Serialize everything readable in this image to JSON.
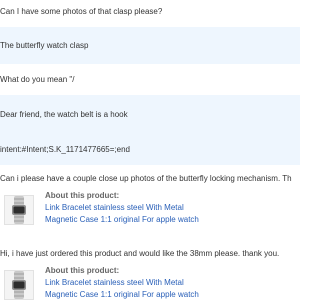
{
  "messages": [
    {
      "role": "buyer",
      "text": "Can I have some photos of that clasp please?"
    },
    {
      "role": "seller",
      "text": "The butterfly watch clasp"
    },
    {
      "role": "buyer",
      "text": "What do you mean \"/"
    },
    {
      "role": "seller",
      "text": "Dear friend, the watch belt is a hook"
    },
    {
      "role": "seller",
      "text": "intent:#Intent;S.K_1171477665=;end"
    },
    {
      "role": "buyer",
      "text": "Can i please have a couple close up photos of the butterfly locking mechanism. Th"
    },
    {
      "role": "buyer",
      "text": "Hi, i have just ordered this product and would like the 38mm please. thank you."
    }
  ],
  "product_card": {
    "title": "About this product:",
    "link_line1": "Link Bracelet stainless steel With Metal",
    "link_line2": "Magnetic Case 1:1 original For apple watch",
    "thumbnail_icon": "watch-bracelet-thumbnail"
  },
  "colors": {
    "seller_background": "#eef6fe",
    "buyer_background": "#ffffff",
    "link": "#2a60b8"
  }
}
